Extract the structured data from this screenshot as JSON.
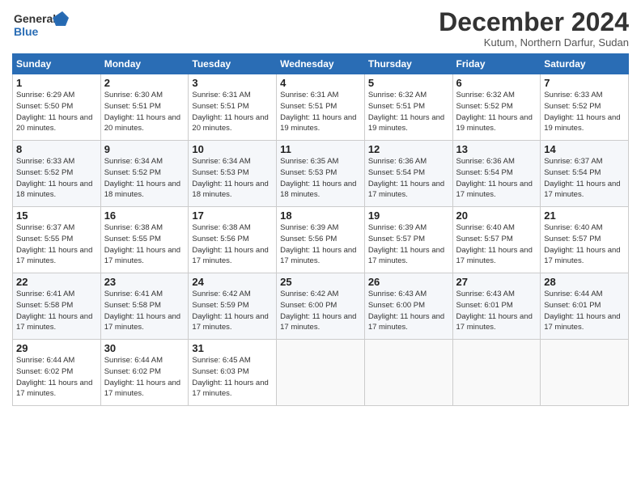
{
  "logo": {
    "line1": "General",
    "line2": "Blue"
  },
  "title": "December 2024",
  "subtitle": "Kutum, Northern Darfur, Sudan",
  "days_of_week": [
    "Sunday",
    "Monday",
    "Tuesday",
    "Wednesday",
    "Thursday",
    "Friday",
    "Saturday"
  ],
  "weeks": [
    [
      {
        "day": "1",
        "sunrise": "6:29 AM",
        "sunset": "5:50 PM",
        "daylight": "11 hours and 20 minutes."
      },
      {
        "day": "2",
        "sunrise": "6:30 AM",
        "sunset": "5:51 PM",
        "daylight": "11 hours and 20 minutes."
      },
      {
        "day": "3",
        "sunrise": "6:31 AM",
        "sunset": "5:51 PM",
        "daylight": "11 hours and 20 minutes."
      },
      {
        "day": "4",
        "sunrise": "6:31 AM",
        "sunset": "5:51 PM",
        "daylight": "11 hours and 19 minutes."
      },
      {
        "day": "5",
        "sunrise": "6:32 AM",
        "sunset": "5:51 PM",
        "daylight": "11 hours and 19 minutes."
      },
      {
        "day": "6",
        "sunrise": "6:32 AM",
        "sunset": "5:52 PM",
        "daylight": "11 hours and 19 minutes."
      },
      {
        "day": "7",
        "sunrise": "6:33 AM",
        "sunset": "5:52 PM",
        "daylight": "11 hours and 19 minutes."
      }
    ],
    [
      {
        "day": "8",
        "sunrise": "6:33 AM",
        "sunset": "5:52 PM",
        "daylight": "11 hours and 18 minutes."
      },
      {
        "day": "9",
        "sunrise": "6:34 AM",
        "sunset": "5:52 PM",
        "daylight": "11 hours and 18 minutes."
      },
      {
        "day": "10",
        "sunrise": "6:34 AM",
        "sunset": "5:53 PM",
        "daylight": "11 hours and 18 minutes."
      },
      {
        "day": "11",
        "sunrise": "6:35 AM",
        "sunset": "5:53 PM",
        "daylight": "11 hours and 18 minutes."
      },
      {
        "day": "12",
        "sunrise": "6:36 AM",
        "sunset": "5:54 PM",
        "daylight": "11 hours and 17 minutes."
      },
      {
        "day": "13",
        "sunrise": "6:36 AM",
        "sunset": "5:54 PM",
        "daylight": "11 hours and 17 minutes."
      },
      {
        "day": "14",
        "sunrise": "6:37 AM",
        "sunset": "5:54 PM",
        "daylight": "11 hours and 17 minutes."
      }
    ],
    [
      {
        "day": "15",
        "sunrise": "6:37 AM",
        "sunset": "5:55 PM",
        "daylight": "11 hours and 17 minutes."
      },
      {
        "day": "16",
        "sunrise": "6:38 AM",
        "sunset": "5:55 PM",
        "daylight": "11 hours and 17 minutes."
      },
      {
        "day": "17",
        "sunrise": "6:38 AM",
        "sunset": "5:56 PM",
        "daylight": "11 hours and 17 minutes."
      },
      {
        "day": "18",
        "sunrise": "6:39 AM",
        "sunset": "5:56 PM",
        "daylight": "11 hours and 17 minutes."
      },
      {
        "day": "19",
        "sunrise": "6:39 AM",
        "sunset": "5:57 PM",
        "daylight": "11 hours and 17 minutes."
      },
      {
        "day": "20",
        "sunrise": "6:40 AM",
        "sunset": "5:57 PM",
        "daylight": "11 hours and 17 minutes."
      },
      {
        "day": "21",
        "sunrise": "6:40 AM",
        "sunset": "5:57 PM",
        "daylight": "11 hours and 17 minutes."
      }
    ],
    [
      {
        "day": "22",
        "sunrise": "6:41 AM",
        "sunset": "5:58 PM",
        "daylight": "11 hours and 17 minutes."
      },
      {
        "day": "23",
        "sunrise": "6:41 AM",
        "sunset": "5:58 PM",
        "daylight": "11 hours and 17 minutes."
      },
      {
        "day": "24",
        "sunrise": "6:42 AM",
        "sunset": "5:59 PM",
        "daylight": "11 hours and 17 minutes."
      },
      {
        "day": "25",
        "sunrise": "6:42 AM",
        "sunset": "6:00 PM",
        "daylight": "11 hours and 17 minutes."
      },
      {
        "day": "26",
        "sunrise": "6:43 AM",
        "sunset": "6:00 PM",
        "daylight": "11 hours and 17 minutes."
      },
      {
        "day": "27",
        "sunrise": "6:43 AM",
        "sunset": "6:01 PM",
        "daylight": "11 hours and 17 minutes."
      },
      {
        "day": "28",
        "sunrise": "6:44 AM",
        "sunset": "6:01 PM",
        "daylight": "11 hours and 17 minutes."
      }
    ],
    [
      {
        "day": "29",
        "sunrise": "6:44 AM",
        "sunset": "6:02 PM",
        "daylight": "11 hours and 17 minutes."
      },
      {
        "day": "30",
        "sunrise": "6:44 AM",
        "sunset": "6:02 PM",
        "daylight": "11 hours and 17 minutes."
      },
      {
        "day": "31",
        "sunrise": "6:45 AM",
        "sunset": "6:03 PM",
        "daylight": "11 hours and 17 minutes."
      },
      null,
      null,
      null,
      null
    ]
  ]
}
